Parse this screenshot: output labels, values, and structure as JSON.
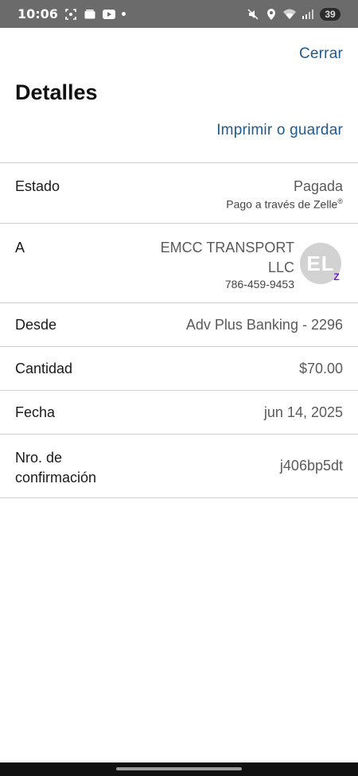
{
  "status_bar": {
    "time": "10:06",
    "battery": "39",
    "left_icons": [
      "screenshot-icon",
      "gallery-icon",
      "youtube-icon"
    ],
    "right_icons": [
      "mute-icon",
      "location-icon",
      "wifi-icon",
      "signal-icon"
    ]
  },
  "header": {
    "close_label": "Cerrar",
    "title": "Detalles",
    "print_label": "Imprimir o guardar"
  },
  "details": {
    "estado": {
      "label": "Estado",
      "value": "Pagada",
      "sub": "Pago a través de Zelle",
      "sub_mark": "®"
    },
    "a": {
      "label": "A",
      "name": "EMCC TRANSPORT LLC",
      "phone": "786-459-9453",
      "avatar_initials": "EL",
      "badge": "Z"
    },
    "desde": {
      "label": "Desde",
      "value": "Adv Plus Banking - 2296"
    },
    "cantidad": {
      "label": "Cantidad",
      "value": "$70.00"
    },
    "fecha": {
      "label": "Fecha",
      "value": "jun 14, 2025"
    },
    "confirmacion": {
      "label": "Nro. de confirmación",
      "value": "j406bp5dt"
    }
  },
  "colors": {
    "link": "#1d5a8e",
    "zelle_purple": "#6d1ed4",
    "status_bar": "#6b6b6b"
  }
}
